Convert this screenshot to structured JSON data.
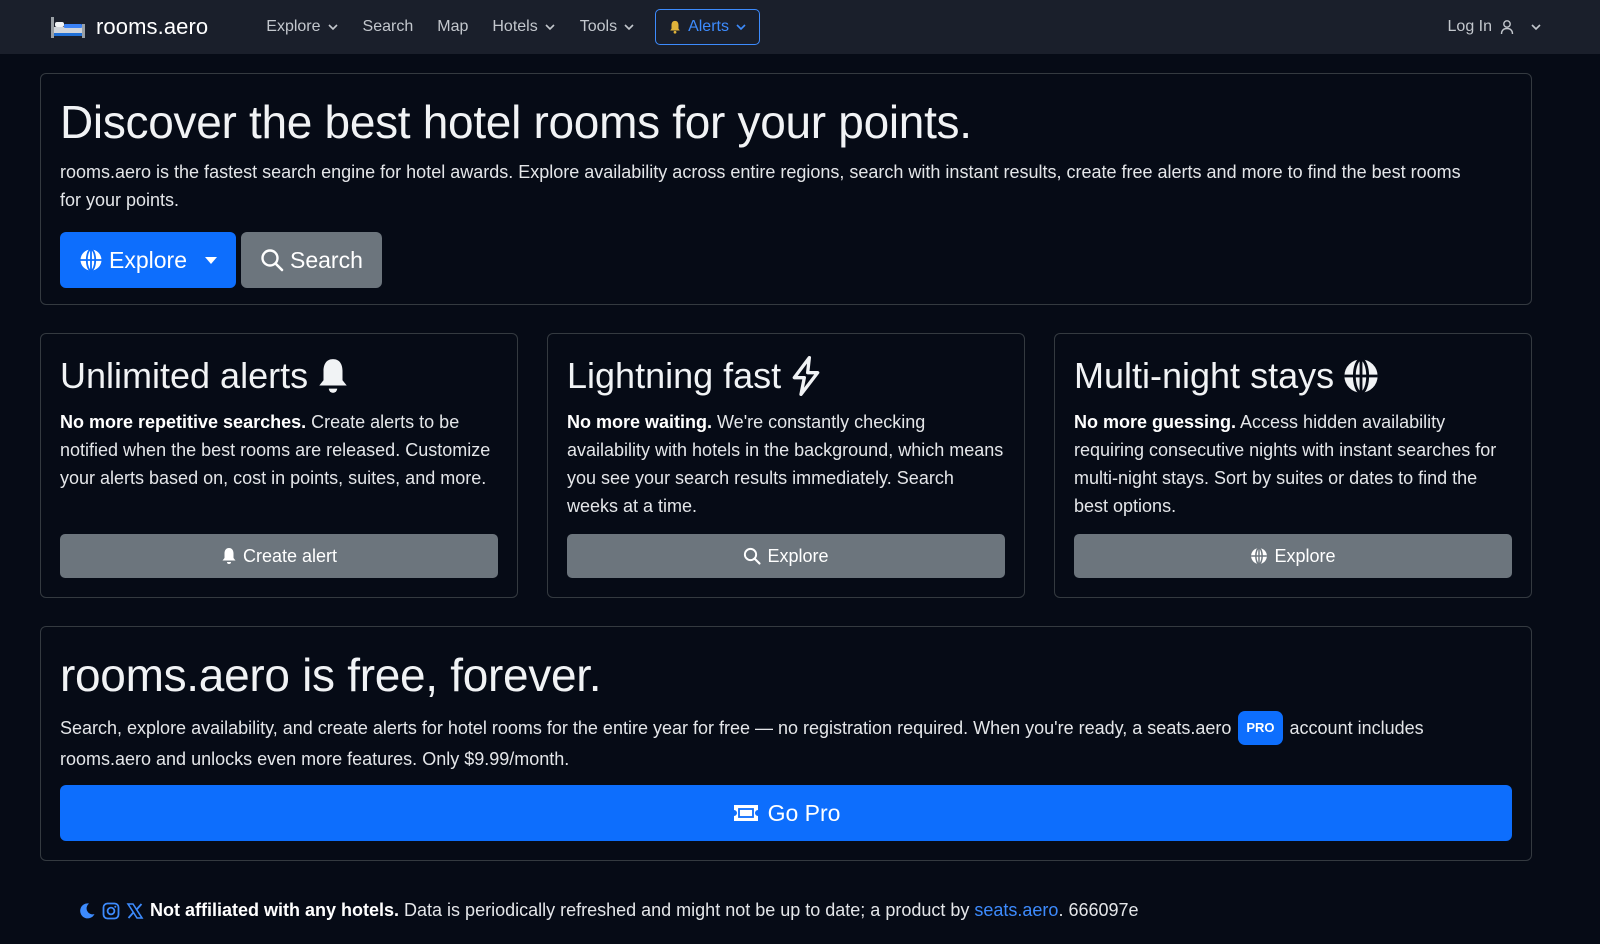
{
  "colors": {
    "accent": "#0d6efd",
    "secondary": "#6c757d",
    "background": "#060b16",
    "navbar": "#1a1f2b"
  },
  "brand": {
    "name": "rooms.aero",
    "icon": "bed-icon"
  },
  "nav": {
    "items": [
      {
        "label": "Explore",
        "dropdown": true
      },
      {
        "label": "Search",
        "dropdown": false
      },
      {
        "label": "Map",
        "dropdown": false
      },
      {
        "label": "Hotels",
        "dropdown": true
      },
      {
        "label": "Tools",
        "dropdown": true
      }
    ],
    "alerts_label": "Alerts",
    "login_label": "Log In"
  },
  "hero": {
    "title": "Discover the best hotel rooms for your points.",
    "description": "rooms.aero is the fastest search engine for hotel awards. Explore availability across entire regions, search with instant results, create free alerts and more to find the best rooms for your points.",
    "explore_label": "Explore",
    "search_label": "Search"
  },
  "features": [
    {
      "title": "Unlimited alerts",
      "icon": "bell-icon",
      "lead": "No more repetitive searches.",
      "text": " Create alerts to be notified when the best rooms are released. Customize your alerts based on, cost in points, suites, and more.",
      "button": "Create alert",
      "button_icon": "bell-icon"
    },
    {
      "title": "Lightning fast",
      "icon": "lightning-icon",
      "lead": "No more waiting.",
      "text": " We're constantly checking availability with hotels in the background, which means you see your search results immediately. Search weeks at a time.",
      "button": "Explore",
      "button_icon": "search-icon"
    },
    {
      "title": "Multi-night stays",
      "icon": "globe-icon",
      "lead": "No more guessing.",
      "text": " Access hidden availability requiring consecutive nights with instant searches for multi-night stays. Sort by suites or dates to find the best options.",
      "button": "Explore",
      "button_icon": "globe-icon"
    }
  ],
  "free": {
    "title": "rooms.aero is free, forever.",
    "text_before": "Search, explore availability, and create alerts for hotel rooms for the entire year for free — no registration required. When you're ready, a seats.aero ",
    "badge": "PRO",
    "text_after": " account includes rooms.aero and unlocks even more features. Only $9.99/month.",
    "button": "Go Pro"
  },
  "footer": {
    "bold": "Not affiliated with any hotels.",
    "text": " Data is periodically refreshed and might not be up to date; a product by ",
    "link": "seats.aero",
    "version": ". 666097e"
  }
}
